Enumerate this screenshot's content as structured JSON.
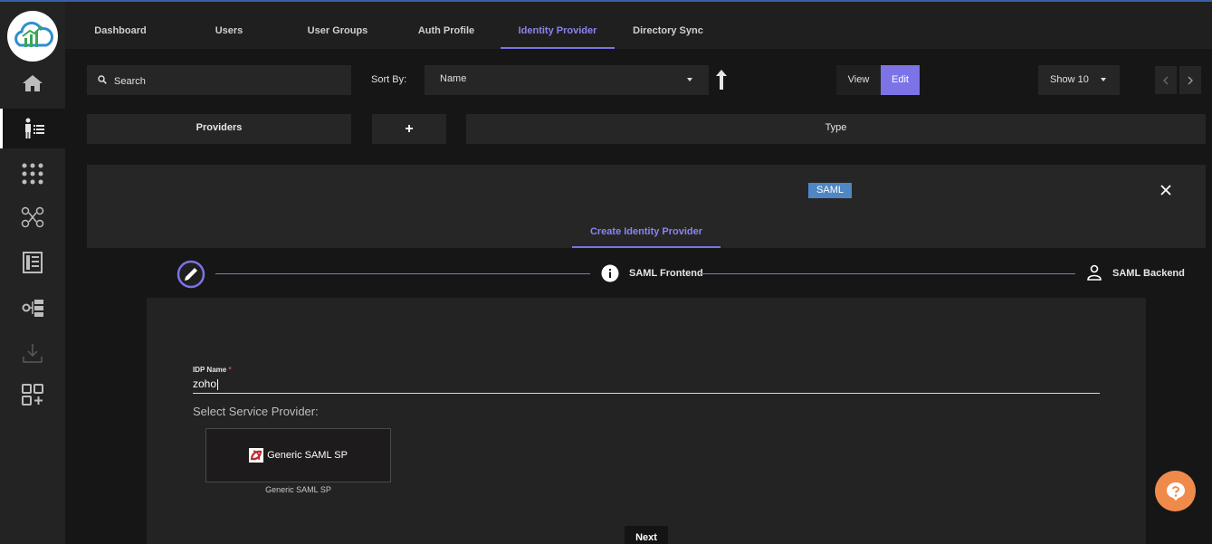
{
  "tabs": [
    {
      "label": "Dashboard"
    },
    {
      "label": "Users"
    },
    {
      "label": "User Groups"
    },
    {
      "label": "Auth Profile"
    },
    {
      "label": "Identity Provider",
      "active": true
    },
    {
      "label": "Directory Sync"
    }
  ],
  "toolbar": {
    "search_label": "Search",
    "sort_by_label": "Sort By:",
    "sort_value": "Name",
    "view_label": "View",
    "edit_label": "Edit",
    "show_value": "Show 10"
  },
  "table_header": {
    "providers": "Providers",
    "add": "+",
    "type": "Type"
  },
  "panel": {
    "badge": "SAML",
    "create_tab": "Create Identity Provider"
  },
  "stepper": {
    "step2_label": "SAML Frontend",
    "step3_label": "SAML Backend"
  },
  "form": {
    "idp_name_label": "IDP Name",
    "required_mark": "*",
    "idp_name_value": "zoho",
    "select_sp_label": "Select Service Provider:",
    "sp_tile_label": "Generic SAML SP",
    "sp_caption": "Generic SAML SP",
    "next_label": "Next"
  },
  "colors": {
    "accent": "#7b73e6",
    "badge": "#4f86c4",
    "help": "#f08a4b"
  }
}
